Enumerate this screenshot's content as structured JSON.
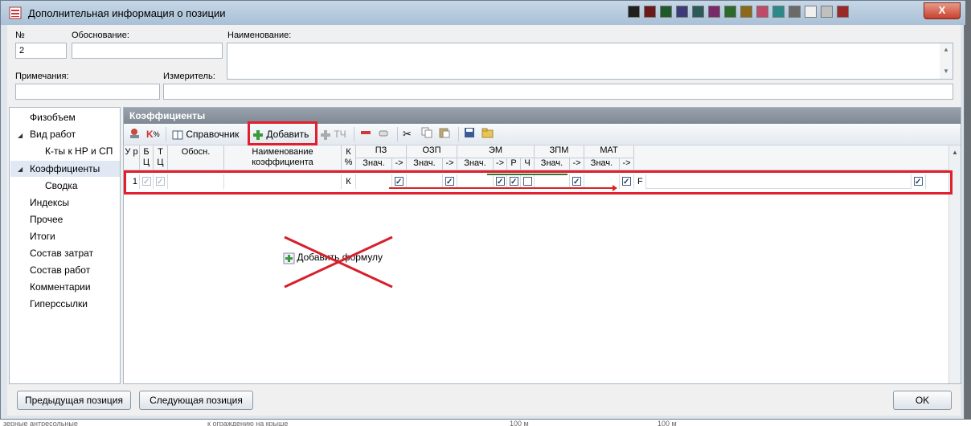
{
  "window": {
    "title": "Дополнительная информация о позиции",
    "close_label": "X",
    "swatch_colors": [
      "#1f1f1f",
      "#6a1a1a",
      "#1f5a2a",
      "#3c3c7a",
      "#2b5a5a",
      "#7a2a6a",
      "#2a6a2a",
      "#8a6a1a",
      "#c04a6a",
      "#2a8a8a",
      "#6a6a6a",
      "#f0f0f0",
      "#c0c0c0",
      "#9a2a2a"
    ]
  },
  "fields": {
    "no_label": "№",
    "no_value": "2",
    "basis_label": "Обоснование:",
    "basis_value": "",
    "name_label": "Наименование:",
    "name_value": "",
    "notes_label": "Примечания:",
    "notes_value": "",
    "meter_label": "Измеритель:",
    "meter_value": ""
  },
  "nav": {
    "items": [
      {
        "label": "Физобъем"
      },
      {
        "label": "Вид работ"
      },
      {
        "label": "К-ты к НР и СП"
      },
      {
        "label": "Коэффициенты"
      },
      {
        "label": "Сводка"
      },
      {
        "label": "Индексы"
      },
      {
        "label": "Прочее"
      },
      {
        "label": "Итоги"
      },
      {
        "label": "Состав затрат"
      },
      {
        "label": "Состав работ"
      },
      {
        "label": "Комментарии"
      },
      {
        "label": "Гиперссылки"
      }
    ]
  },
  "panel": {
    "title": "Коэффициенты",
    "toolbar": {
      "reference": "Справочник",
      "add": "Добавить",
      "tch": "ТЧ",
      "kpercent": "К%"
    },
    "columns": {
      "ur": "У р",
      "bc": "Б Ц",
      "tc": "Т Ц",
      "obosn": "Обосн.",
      "name": "Наименование коэффициента",
      "kp": "К %",
      "pz": "ПЗ",
      "ozp": "ОЗП",
      "em": "ЭМ",
      "zpm": "ЗПМ",
      "mat": "МАТ",
      "znach": "Знач.",
      "arrow": "->",
      "r": "Р",
      "ch": "Ч"
    },
    "row": {
      "num": "1",
      "kp": "К",
      "f": "F"
    },
    "add_formula": "Добавить формулу"
  },
  "buttons": {
    "prev": "Предыдущая позиция",
    "next": "Следующая позиция",
    "ok": "OK"
  },
  "background_strip": {
    "left": "зерные антресольные",
    "mid": "к ограждению на крыше",
    "m1": "100 м",
    "m2": "100 м"
  }
}
